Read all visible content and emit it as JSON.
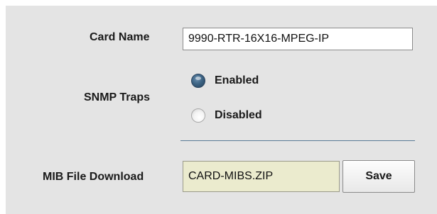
{
  "form": {
    "card_name": {
      "label": "Card Name",
      "value": "9990-RTR-16X16-MPEG-IP"
    },
    "snmp_traps": {
      "label": "SNMP Traps",
      "options": [
        {
          "label": "Enabled",
          "selected": true
        },
        {
          "label": "Disabled",
          "selected": false
        }
      ]
    },
    "mib_file_download": {
      "label": "MIB File Download",
      "value": "CARD-MIBS.ZIP",
      "button_label": "Save"
    }
  },
  "colors": {
    "panel_background": "#e4e4e4",
    "readonly_field_background": "#ebebce",
    "divider": "#5a7b96",
    "radio_selected": "#3e6585"
  }
}
